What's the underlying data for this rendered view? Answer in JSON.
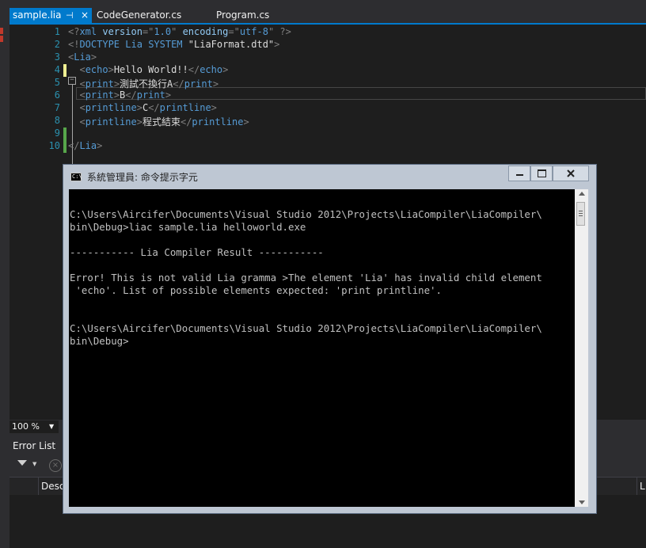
{
  "tabs": [
    {
      "label": "sample.lia",
      "pin": "⊣",
      "close": "×"
    },
    {
      "label": "CodeGenerator.cs"
    },
    {
      "label": "Program.cs"
    }
  ],
  "editor": {
    "line_numbers": [
      "1",
      "2",
      "3",
      "4",
      "5",
      "6",
      "7",
      "8",
      "9",
      "10"
    ],
    "lines": [
      [
        {
          "c": "d",
          "t": "<?"
        },
        {
          "c": "k",
          "t": "xml"
        },
        {
          "c": "t",
          "t": " "
        },
        {
          "c": "a",
          "t": "version"
        },
        {
          "c": "d",
          "t": "=\""
        },
        {
          "c": "k",
          "t": "1.0"
        },
        {
          "c": "d",
          "t": "\""
        },
        {
          "c": "t",
          "t": " "
        },
        {
          "c": "a",
          "t": "encoding"
        },
        {
          "c": "d",
          "t": "=\""
        },
        {
          "c": "k",
          "t": "utf-8"
        },
        {
          "c": "d",
          "t": "\""
        },
        {
          "c": "t",
          "t": " "
        },
        {
          "c": "d",
          "t": "?>"
        }
      ],
      [
        {
          "c": "d",
          "t": "<!"
        },
        {
          "c": "k",
          "t": "DOCTYPE"
        },
        {
          "c": "t",
          "t": " "
        },
        {
          "c": "k",
          "t": "Lia"
        },
        {
          "c": "t",
          "t": " "
        },
        {
          "c": "k",
          "t": "SYSTEM"
        },
        {
          "c": "t",
          "t": " "
        },
        {
          "c": "t",
          "t": "\"LiaFormat.dtd\""
        },
        {
          "c": "d",
          "t": ">"
        }
      ],
      [
        {
          "c": "d",
          "t": "<"
        },
        {
          "c": "k",
          "t": "Lia"
        },
        {
          "c": "d",
          "t": ">"
        }
      ],
      [
        {
          "c": "t",
          "t": "  "
        },
        {
          "c": "d",
          "t": "<"
        },
        {
          "c": "k",
          "t": "echo"
        },
        {
          "c": "d",
          "t": ">"
        },
        {
          "c": "t",
          "t": "Hello World!!"
        },
        {
          "c": "d",
          "t": "</"
        },
        {
          "c": "k",
          "t": "echo"
        },
        {
          "c": "d",
          "t": ">"
        }
      ],
      [
        {
          "c": "t",
          "t": "  "
        },
        {
          "c": "d",
          "t": "<"
        },
        {
          "c": "k",
          "t": "print"
        },
        {
          "c": "d",
          "t": ">"
        },
        {
          "c": "t",
          "t": "測試不換行A"
        },
        {
          "c": "d",
          "t": "</"
        },
        {
          "c": "k",
          "t": "print"
        },
        {
          "c": "d",
          "t": ">"
        }
      ],
      [
        {
          "c": "t",
          "t": "  "
        },
        {
          "c": "d",
          "t": "<"
        },
        {
          "c": "k",
          "t": "print"
        },
        {
          "c": "d",
          "t": ">"
        },
        {
          "c": "t",
          "t": "B"
        },
        {
          "c": "d",
          "t": "</"
        },
        {
          "c": "k",
          "t": "print"
        },
        {
          "c": "d",
          "t": ">"
        }
      ],
      [
        {
          "c": "t",
          "t": "  "
        },
        {
          "c": "d",
          "t": "<"
        },
        {
          "c": "k",
          "t": "printline"
        },
        {
          "c": "d",
          "t": ">"
        },
        {
          "c": "t",
          "t": "C"
        },
        {
          "c": "d",
          "t": "</"
        },
        {
          "c": "k",
          "t": "printline"
        },
        {
          "c": "d",
          "t": ">"
        }
      ],
      [
        {
          "c": "t",
          "t": "  "
        },
        {
          "c": "d",
          "t": "<"
        },
        {
          "c": "k",
          "t": "printline"
        },
        {
          "c": "d",
          "t": ">"
        },
        {
          "c": "t",
          "t": "程式結束"
        },
        {
          "c": "d",
          "t": "</"
        },
        {
          "c": "k",
          "t": "printline"
        },
        {
          "c": "d",
          "t": ">"
        }
      ],
      [],
      [
        {
          "c": "d",
          "t": "</"
        },
        {
          "c": "k",
          "t": "Lia"
        },
        {
          "c": "d",
          "t": ">"
        }
      ]
    ],
    "fold_glyph": "−"
  },
  "zoom": {
    "value": "100 %",
    "dropdown": "▼"
  },
  "error_list": {
    "title": "Error List",
    "clear_glyph": "×",
    "filter_dd": "▼",
    "columns": {
      "description": "Desc",
      "line": "L"
    }
  },
  "console": {
    "icon_text": "C:\\",
    "title": "系統管理員: 命令提示字元",
    "lines": [
      "",
      "C:\\Users\\Aircifer\\Documents\\Visual Studio 2012\\Projects\\LiaCompiler\\LiaCompiler\\",
      "bin\\Debug>liac sample.lia helloworld.exe",
      "",
      "----------- Lia Compiler Result -----------",
      "",
      "Error! This is not valid Lia gramma >The element 'Lia' has invalid child element",
      " 'echo'. List of possible elements expected: 'print printline'.",
      "",
      "",
      "C:\\Users\\Aircifer\\Documents\\Visual Studio 2012\\Projects\\LiaCompiler\\LiaCompiler\\",
      "bin\\Debug>"
    ]
  },
  "colors": {
    "accent": "#007acc",
    "editor_bg": "#1e1e1e",
    "chrome_bg": "#2d2d30",
    "line_number": "#2b91af",
    "xml_keyword": "#569cd6",
    "xml_delimiter": "#808080",
    "console_bg": "#000000",
    "console_text": "#c0c0c0"
  },
  "icons": [
    "pin-icon",
    "close-icon",
    "fold-icon",
    "filter-icon",
    "clear-icon",
    "console-icon",
    "minimize-icon",
    "maximize-icon",
    "window-close-icon",
    "scroll-up-icon",
    "scroll-down-icon"
  ]
}
